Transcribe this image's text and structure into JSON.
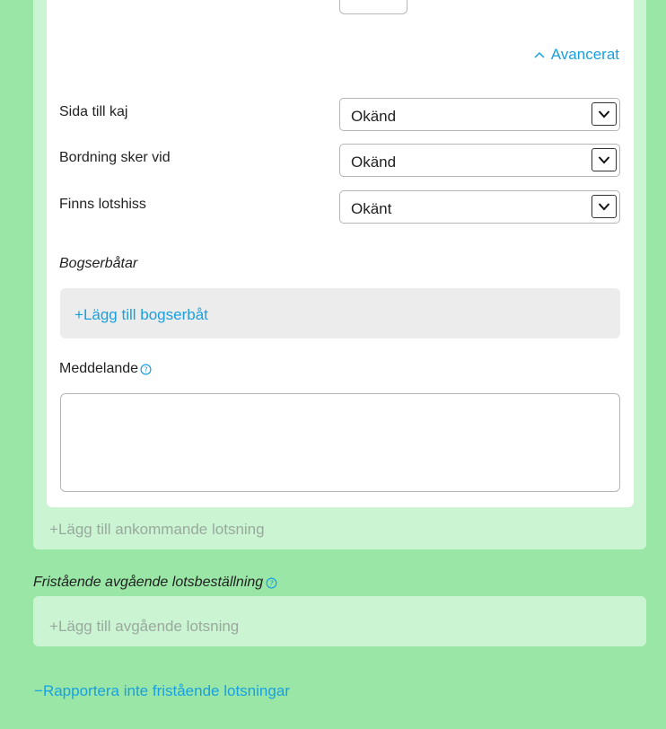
{
  "advanced_toggle": {
    "label": "Avancerat"
  },
  "fields": [
    {
      "label": "Sida till kaj",
      "value": "Okänd"
    },
    {
      "label": "Bordning sker vid",
      "value": "Okänd"
    },
    {
      "label": "Finns lotshiss",
      "value": "Okänt"
    }
  ],
  "tugboats": {
    "title": "Bogserbåtar",
    "add_label": "Lägg till bogserbåt"
  },
  "message": {
    "label": "Meddelande",
    "value": ""
  },
  "incoming": {
    "add_label": "Lägg till ankommande lotsning"
  },
  "outgoing": {
    "title": "Fristående avgående lotsbeställning",
    "add_label": "Lägg till avgående lotsning"
  },
  "no_report": {
    "label": "Rapportera inte fristående lotsningar"
  },
  "colors": {
    "background": "#99e6a6",
    "panel": "#cbf4d3",
    "link": "#1aa0e0",
    "muted": "#9aa99d"
  }
}
